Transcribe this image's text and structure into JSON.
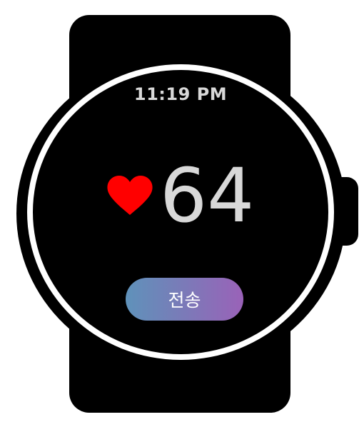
{
  "watch": {
    "time": "11:19 PM",
    "heart_rate": "64",
    "heart_icon": "heart-icon",
    "send_label": "전송"
  },
  "colors": {
    "heart": "#ff0000",
    "button_gradient_start": "#5f92ba",
    "button_gradient_end": "#9a62b8",
    "text": "#d8d8d8"
  }
}
